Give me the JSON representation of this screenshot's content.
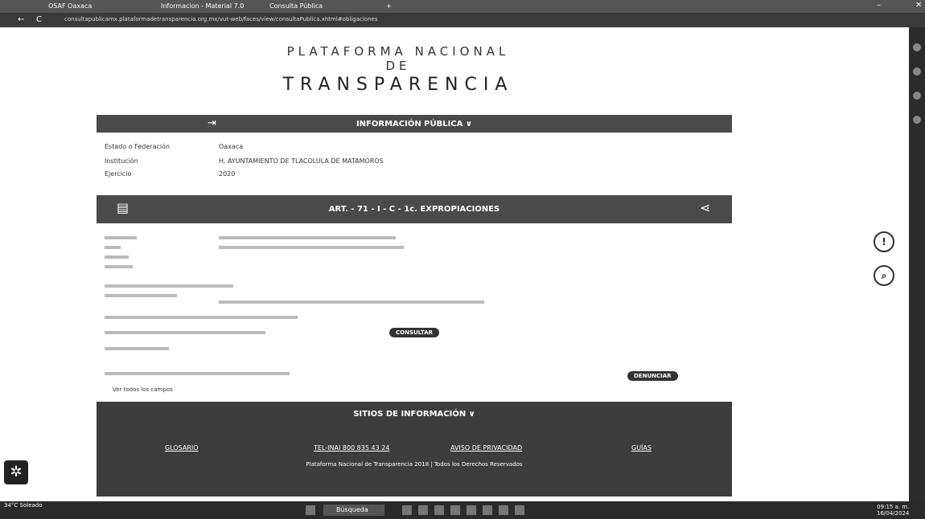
{
  "browser": {
    "tabs": [
      "OSAF Oaxaca",
      "Informacion - Material 7.0",
      "Consulta Pública"
    ],
    "new_tab": "+",
    "url": "consultapublicamx.plataformadetransparencia.org.mx/vut-web/faces/view/consultaPublica.xhtml#obligaciones",
    "nav_back": "←",
    "nav_refresh": "C"
  },
  "header": {
    "line1": "PLATAFORMA NACIONAL DE",
    "line2": "TRANSPARENCIA"
  },
  "info_bar": {
    "title": "INFORMACIÓN PÚBLICA ∨"
  },
  "filters": [
    {
      "label": "Estado o Federación",
      "value": "Oaxaca"
    },
    {
      "label": "Institución",
      "value": "H. AYUNTAMIENTO DE TLACOLULA DE MATAMOROS"
    },
    {
      "label": "Ejercicio",
      "value": "2020"
    }
  ],
  "art_bar": {
    "title": "ART. - 71 - I - C - 1c. EXPROPIACIONES"
  },
  "details": {
    "consultar_label": "CONSULTAR",
    "denunciar_label": "DENUNCIAR",
    "view_more": "Ver todos los campos"
  },
  "footer": {
    "title": "SITIOS DE INFORMACIÓN ∨",
    "links": [
      "GLOSARIO",
      "TEL-INAI 800 835 43 24",
      "AVISO DE PRIVACIDAD",
      "GUÍAS"
    ],
    "copyright": "Plataforma Nacional de Transparencia 2018 | Todos los Derechos Reservados"
  },
  "taskbar": {
    "search": "Búsqueda",
    "time": "09:15 a. m.",
    "date": "16/04/2024",
    "left_app": "34°C Soleado"
  }
}
